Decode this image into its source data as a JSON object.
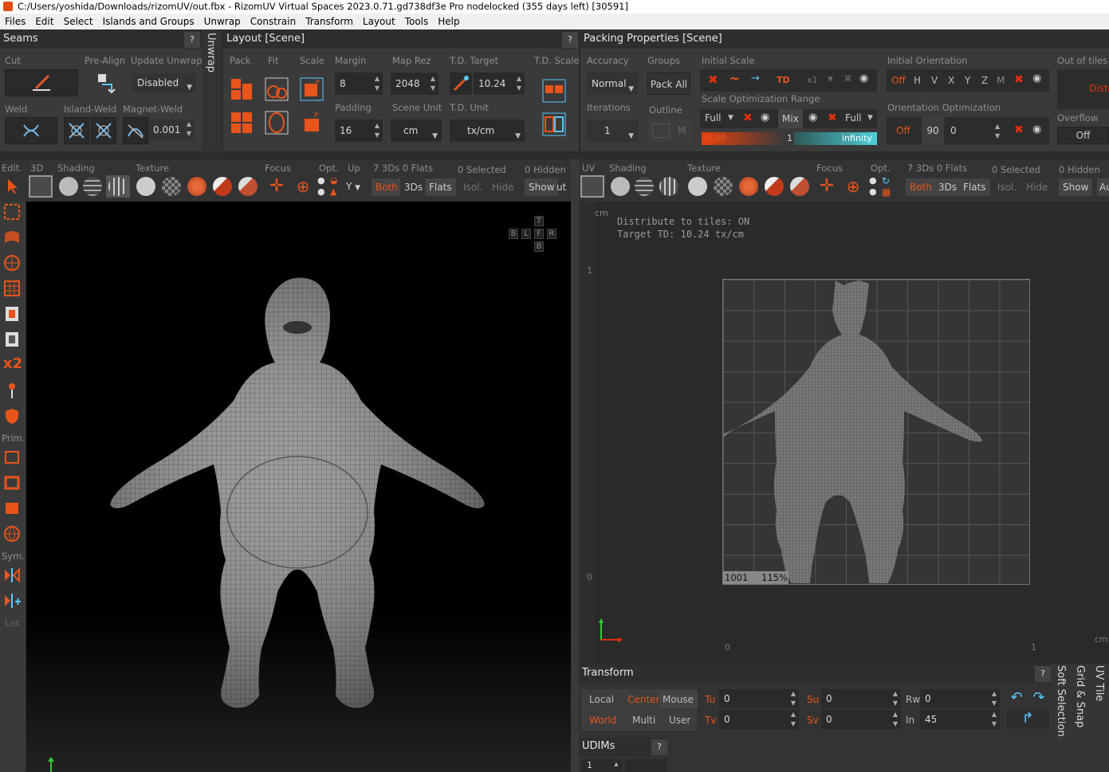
{
  "title": "C:/Users/yoshida/Downloads/rizomUV/out.fbx - RizomUV  Virtual Spaces 2023.0.71.gd738df3e Pro nodelocked  (355 days left) [30591]",
  "menu": [
    "Files",
    "Edit",
    "Select",
    "Islands and Groups",
    "Unwrap",
    "Constrain",
    "Transform",
    "Layout",
    "Tools",
    "Help"
  ],
  "seams": {
    "title": "Seams",
    "cut": "Cut",
    "pre_align": "Pre-Align",
    "update_unwrap": "Update Unwrap",
    "update_value": "Disabled",
    "weld": "Weld",
    "island_weld": "Island-Weld",
    "magnet_weld": "Magnet-Weld",
    "magnet_value": "0.001",
    "unwrap_tab": "Unwrap"
  },
  "layout": {
    "title": "Layout [Scene]",
    "pack": "Pack",
    "fit": "Fit",
    "scale": "Scale",
    "margin": "Margin",
    "margin_value": "8",
    "map_rez": "Map Rez",
    "map_rez_value": "2048",
    "td_target": "T.D. Target",
    "td_target_value": "10.24",
    "td_scale": "T.D. Scale",
    "padding": "Padding",
    "padding_value": "16",
    "scene_unit": "Scene Unit",
    "scene_unit_value": "cm",
    "td_unit": "T.D. Unit",
    "td_unit_value": "tx/cm"
  },
  "packing": {
    "title": "Packing Properties [Scene]",
    "accuracy": "Accuracy",
    "accuracy_value": "Normal",
    "groups": "Groups",
    "pack_all": "Pack All",
    "iterations": "Iterations",
    "iterations_value": "1",
    "outline": "Outline",
    "outline_m": "M",
    "initial_scale": "Initial Scale",
    "td": "TD",
    "x1": "x1",
    "scale_opt_range": "Scale Optimization Range",
    "full1": "Full",
    "mix": "Mix",
    "full2": "Full",
    "range_min": "0.00",
    "range_mid": "1",
    "range_max": "infinity",
    "initial_orientation": "Initial Orientation",
    "orient_off": "Off",
    "orient_axes": [
      "H",
      "V",
      "X",
      "Y",
      "Z",
      "M"
    ],
    "orientation_opt": "Orientation Optimization",
    "opt_off": "Off",
    "opt_step": "90",
    "opt_value": "0",
    "out_of_tiles": "Out of tiles",
    "distribute": "Distribute",
    "overflow": "Overflow",
    "overflow_value": "Off"
  },
  "view3d": {
    "edit": "Edit.",
    "mode": "3D",
    "shading": "Shading",
    "texture": "Texture",
    "focus": "Focus",
    "opt": "Opt.",
    "up": "Up",
    "up_value": "Y",
    "counts": "7 3Ds 0 Flats",
    "selected": "0 Selected",
    "hidden": "0 Hidden",
    "both": "Both",
    "threeds": "3Ds",
    "flats": "Flats",
    "isol": "Isol.",
    "hide": "Hide",
    "show": "Show",
    "cut": "ut",
    "cube": [
      "T",
      "B",
      "L",
      "F",
      "R",
      "B"
    ],
    "prim": "Prim.",
    "sym": "Sym.",
    "loc": "Loc",
    "x2": "x2"
  },
  "viewuv": {
    "mode": "UV",
    "shading": "Shading",
    "texture": "Texture",
    "focus": "Focus",
    "opt": "Opt.",
    "counts": "7 3Ds 0 Flats",
    "selected": "0 Selected",
    "hidden": "0 Hidden",
    "both": "Both",
    "threeds": "3Ds",
    "flats": "Flats",
    "isol": "Isol.",
    "hide": "Hide",
    "show": "Show",
    "auto": "Au",
    "unit": "cm",
    "unit_right": "cm",
    "info1": "Distribute to tiles: ON",
    "info2": "Target TD: 10.24 tx/cm",
    "axis_1_v": "1",
    "axis_0_v": "0",
    "axis_0_u": "0",
    "axis_1_u": "1",
    "tile_id": "1001",
    "tile_zoom": "115%"
  },
  "transform": {
    "title": "Transform",
    "local": "Local",
    "center": "Center",
    "mouse": "Mouse",
    "world": "World",
    "multi": "Multi",
    "user": "User",
    "tu": "Tu",
    "tu_value": "0",
    "tv": "Tv",
    "tv_value": "0",
    "su": "Su",
    "su_value": "0",
    "sv": "Sv",
    "sv_value": "0",
    "rw": "Rw",
    "rw_value": "0",
    "in": "In",
    "in_value": "45"
  },
  "udims": {
    "title": "UDIMs",
    "value": "1"
  },
  "side_tabs": [
    "UV Tile",
    "Grid & Snap",
    "Soft Selection"
  ],
  "help": "?"
}
